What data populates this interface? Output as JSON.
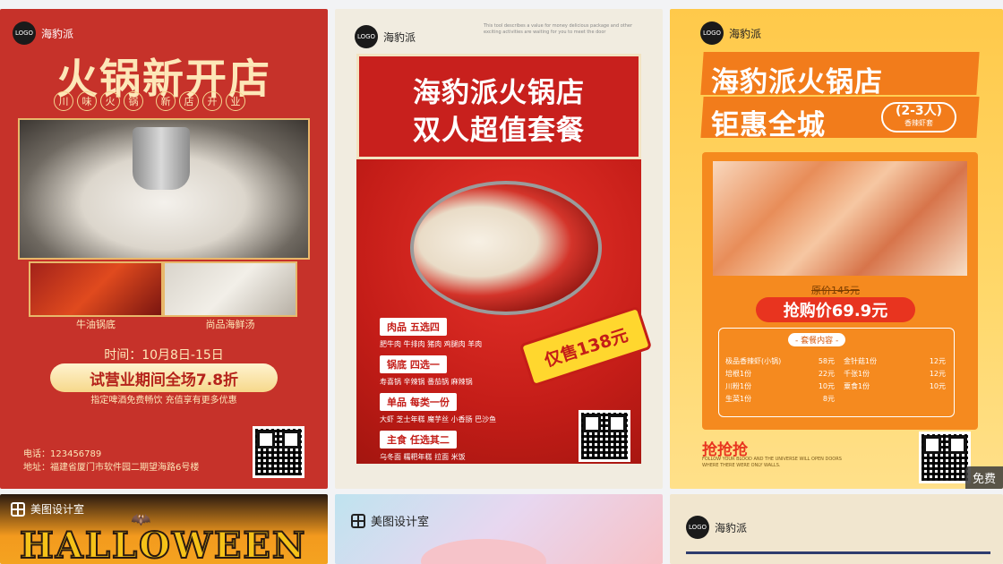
{
  "cards": {
    "c1": {
      "logo": "LOGO",
      "brand": "海豹派",
      "title": "火锅新开店",
      "tags": [
        "川",
        "味",
        "火",
        "锅",
        "新",
        "店",
        "开",
        "业"
      ],
      "sub_left": "牛油锅底",
      "sub_right": "尚品海鲜汤",
      "time": "时间：10月8日-15日",
      "banner": "试营业期间全场7.8折",
      "note": "指定啤酒免费畅饮  充值享有更多优惠",
      "phone": "电话：123456789",
      "address": "地址：福建省厦门市软件园二期望海路6号楼"
    },
    "c2": {
      "logo": "LOGO",
      "brand": "海豹派",
      "eng": "This tool describes a value for money delicious package and other exciting activities are waiting for you to meet the door",
      "title1": "海豹派火锅店",
      "title2": "双人超值套餐",
      "menu": [
        {
          "head": "肉品  五选四",
          "items": "肥牛肉  牛排肉  猪肉  鸡腿肉  羊肉"
        },
        {
          "head": "锅底  四选一",
          "items": "寿喜锅  辛辣锅  番茄锅  麻辣锅"
        },
        {
          "head": "单品  每类一份",
          "items": "大虾  芝士年糕  魔芋丝  小香肠  巴沙鱼"
        },
        {
          "head": "主食  任选其二",
          "items": "乌冬面  糯粑年糕  拉面  米饭"
        }
      ],
      "badge": "仅售138元"
    },
    "c3": {
      "logo": "LOGO",
      "brand": "海豹派",
      "title1": "海豹派火锅店",
      "title2": "钜惠全城",
      "pill": "(2-3人)",
      "pill_sub": "香辣虾套",
      "old_price": "原价145元",
      "price": "抢购价69.9元",
      "box_title": "- 套餐内容 -",
      "rows_left": [
        {
          "name": "极品香辣虾(小锅)",
          "price": "58元"
        },
        {
          "name": "培根1份",
          "price": "22元"
        },
        {
          "name": "川粉1份",
          "price": "10元"
        },
        {
          "name": "生菜1份",
          "price": "8元"
        }
      ],
      "rows_right": [
        {
          "name": "金针菇1份",
          "price": "12元"
        },
        {
          "name": "千张1份",
          "price": "12元"
        },
        {
          "name": "粟食1份",
          "price": "10元"
        }
      ],
      "snatch": "抢抢抢",
      "foot": "FOLLOW YOUR BLOOD AND THE UNIVERSE WILL OPEN DOORS WHERE THERE WERE ONLY WALLS.",
      "free": "免费"
    },
    "c4": {
      "brand": "美图设计室",
      "text": "HALLOWEEN"
    },
    "c5": {
      "brand": "美图设计室"
    },
    "c6": {
      "logo": "LOGO",
      "brand": "海豹派"
    }
  }
}
